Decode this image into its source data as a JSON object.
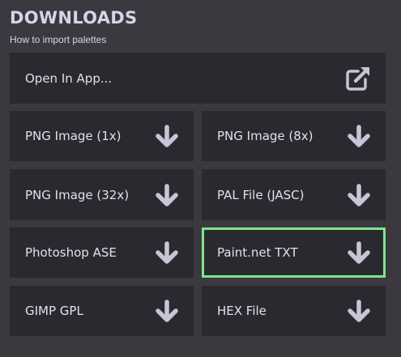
{
  "header": {
    "title": "DOWNLOADS",
    "help_link": "How to import palettes"
  },
  "open_in_app": {
    "label": "Open In App...",
    "icon": "external-link-icon"
  },
  "downloads": [
    {
      "label": "PNG Image (1x)",
      "icon": "download-arrow-icon"
    },
    {
      "label": "PNG Image (8x)",
      "icon": "download-arrow-icon"
    },
    {
      "label": "PNG Image (32x)",
      "icon": "download-arrow-icon"
    },
    {
      "label": "PAL File (JASC)",
      "icon": "download-arrow-icon"
    },
    {
      "label": "Photoshop ASE",
      "icon": "download-arrow-icon"
    },
    {
      "label": "Paint.net TXT",
      "icon": "download-arrow-icon",
      "highlighted": true
    },
    {
      "label": "GIMP GPL",
      "icon": "download-arrow-icon"
    },
    {
      "label": "HEX File",
      "icon": "download-arrow-icon"
    }
  ],
  "colors": {
    "background": "#3b3840",
    "button_background": "#2b2930",
    "title": "#d7d3e8",
    "text": "#e3e0ea",
    "icon": "#c9c4d6",
    "highlight_border": "#7ee58c"
  }
}
